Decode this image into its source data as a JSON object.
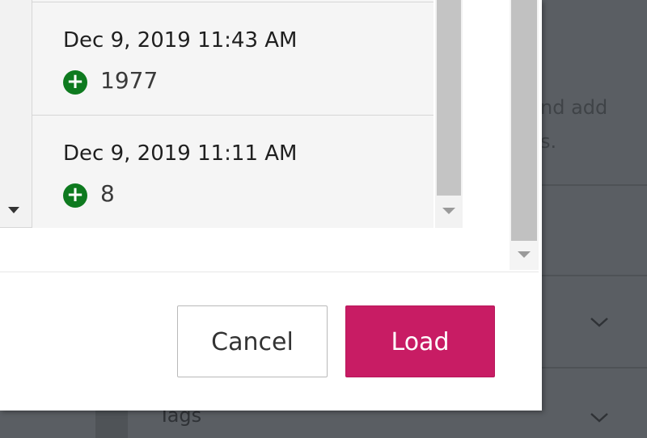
{
  "background": {
    "hint_line1": "nd add",
    "hint_line2": "s.",
    "tags_label": "Tags"
  },
  "history": {
    "items": [
      {
        "date": "Dec 9, 2019 11:43 AM",
        "change_icon": "plus-circle-icon",
        "count": "1977"
      },
      {
        "date": "Dec 9, 2019 11:11 AM",
        "change_icon": "plus-circle-icon",
        "count": "8"
      }
    ]
  },
  "footer": {
    "cancel_label": "Cancel",
    "load_label": "Load"
  },
  "colors": {
    "accent": "#c81c64",
    "add_icon": "#0e7a1f",
    "overlay": "#5a5e63"
  }
}
